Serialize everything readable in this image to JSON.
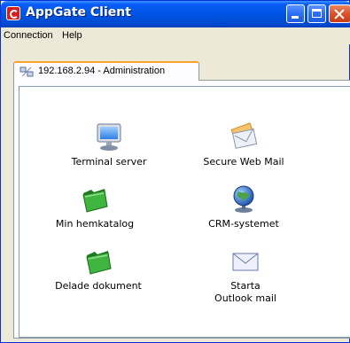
{
  "window": {
    "title": "AppGate Client"
  },
  "menu": {
    "items": [
      "Connection",
      "Help"
    ]
  },
  "tab": {
    "label": "192.168.2.94 - Administration"
  },
  "apps": [
    {
      "label_line1": "Terminal server",
      "label_line2": "",
      "icon": "monitor-icon"
    },
    {
      "label_line1": "Secure Web Mail",
      "label_line2": "",
      "icon": "secure-envelope-icon"
    },
    {
      "label_line1": "Min hemkatalog",
      "label_line2": "",
      "icon": "green-folder-icon"
    },
    {
      "label_line1": "CRM-systemet",
      "label_line2": "",
      "icon": "globe-icon"
    },
    {
      "label_line1": "Delade dokument",
      "label_line2": "",
      "icon": "green-folder-icon"
    },
    {
      "label_line1": "Starta",
      "label_line2": "Outlook mail",
      "icon": "envelope-icon"
    }
  ],
  "colors": {
    "titlebar": "#0054e3",
    "tab_accent": "#f7a428",
    "folder_green": "#2ea02e",
    "close_button": "#d9532c"
  }
}
